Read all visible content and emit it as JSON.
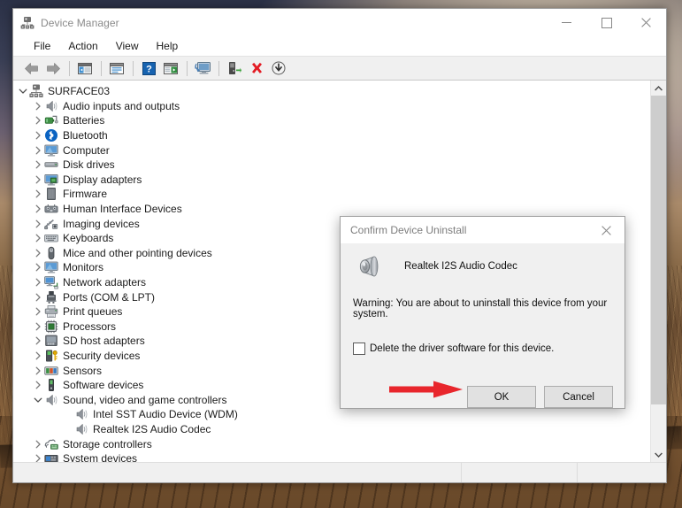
{
  "window": {
    "title": "Device Manager",
    "title_icon": "device-manager-icon",
    "controls": {
      "minimize": "Minimize",
      "maximize": "Maximize",
      "close": "Close"
    }
  },
  "menubar": {
    "items": [
      {
        "label": "File"
      },
      {
        "label": "Action"
      },
      {
        "label": "View"
      },
      {
        "label": "Help"
      }
    ]
  },
  "toolbar": {
    "buttons": [
      {
        "name": "back-icon",
        "title": "Back"
      },
      {
        "name": "forward-icon",
        "title": "Forward"
      },
      {
        "name": "show-hide-console-tree-icon",
        "title": "Show/Hide Console Tree"
      },
      {
        "name": "properties-icon",
        "title": "Properties"
      },
      {
        "name": "help-icon",
        "title": "Help"
      },
      {
        "name": "update-driver-icon",
        "title": "Update Driver Software"
      },
      {
        "name": "scan-for-hardware-changes-icon",
        "title": "Scan for hardware changes"
      },
      {
        "name": "enable-device-icon",
        "title": "Enable device"
      },
      {
        "name": "uninstall-device-icon",
        "title": "Uninstall device"
      },
      {
        "name": "disable-device-icon",
        "title": "Disable device"
      }
    ]
  },
  "tree": {
    "nodes": [
      {
        "label": "SURFACE03",
        "icon": "computer-root-icon",
        "indent": 0,
        "state": "expanded"
      },
      {
        "label": "Audio inputs and outputs",
        "icon": "speaker-icon",
        "indent": 1,
        "state": "collapsed"
      },
      {
        "label": "Batteries",
        "icon": "battery-icon",
        "indent": 1,
        "state": "collapsed"
      },
      {
        "label": "Bluetooth",
        "icon": "bluetooth-icon",
        "indent": 1,
        "state": "collapsed"
      },
      {
        "label": "Computer",
        "icon": "monitor-icon",
        "indent": 1,
        "state": "collapsed"
      },
      {
        "label": "Disk drives",
        "icon": "disk-drive-icon",
        "indent": 1,
        "state": "collapsed"
      },
      {
        "label": "Display adapters",
        "icon": "display-adapter-icon",
        "indent": 1,
        "state": "collapsed"
      },
      {
        "label": "Firmware",
        "icon": "firmware-icon",
        "indent": 1,
        "state": "collapsed"
      },
      {
        "label": "Human Interface Devices",
        "icon": "hid-icon",
        "indent": 1,
        "state": "collapsed"
      },
      {
        "label": "Imaging devices",
        "icon": "imaging-device-icon",
        "indent": 1,
        "state": "collapsed"
      },
      {
        "label": "Keyboards",
        "icon": "keyboard-icon",
        "indent": 1,
        "state": "collapsed"
      },
      {
        "label": "Mice and other pointing devices",
        "icon": "mouse-icon",
        "indent": 1,
        "state": "collapsed"
      },
      {
        "label": "Monitors",
        "icon": "monitor-icon",
        "indent": 1,
        "state": "collapsed"
      },
      {
        "label": "Network adapters",
        "icon": "network-adapter-icon",
        "indent": 1,
        "state": "collapsed"
      },
      {
        "label": "Ports (COM & LPT)",
        "icon": "port-icon",
        "indent": 1,
        "state": "collapsed"
      },
      {
        "label": "Print queues",
        "icon": "printer-icon",
        "indent": 1,
        "state": "collapsed"
      },
      {
        "label": "Processors",
        "icon": "processor-icon",
        "indent": 1,
        "state": "collapsed"
      },
      {
        "label": "SD host adapters",
        "icon": "sd-host-adapter-icon",
        "indent": 1,
        "state": "collapsed"
      },
      {
        "label": "Security devices",
        "icon": "security-device-icon",
        "indent": 1,
        "state": "collapsed"
      },
      {
        "label": "Sensors",
        "icon": "sensor-icon",
        "indent": 1,
        "state": "collapsed"
      },
      {
        "label": "Software devices",
        "icon": "software-device-icon",
        "indent": 1,
        "state": "collapsed"
      },
      {
        "label": "Sound, video and game controllers",
        "icon": "speaker-icon",
        "indent": 1,
        "state": "expanded"
      },
      {
        "label": "Intel SST Audio Device (WDM)",
        "icon": "speaker-icon",
        "indent": 2,
        "state": "leaf"
      },
      {
        "label": "Realtek I2S Audio Codec",
        "icon": "speaker-icon",
        "indent": 2,
        "state": "leaf"
      },
      {
        "label": "Storage controllers",
        "icon": "storage-controller-icon",
        "indent": 1,
        "state": "collapsed"
      },
      {
        "label": "System devices",
        "icon": "system-device-icon",
        "indent": 1,
        "state": "collapsed"
      }
    ]
  },
  "scrollbar": {
    "up_arrow": "scroll-up-icon",
    "down_arrow": "scroll-down-icon"
  },
  "statusbar": {
    "pane1": "",
    "pane2": "",
    "pane3": ""
  },
  "dialog": {
    "title": "Confirm Device Uninstall",
    "close_label": "Close",
    "device_icon": "speaker-large-icon",
    "device_name": "Realtek I2S Audio Codec",
    "warning": "Warning: You are about to uninstall this device from your system.",
    "checkbox": {
      "label": "Delete the driver software for this device.",
      "checked": false
    },
    "buttons": [
      {
        "label": "OK",
        "name": "ok-button"
      },
      {
        "label": "Cancel",
        "name": "cancel-button"
      }
    ]
  },
  "annotation": {
    "arrow": "red-arrow-pointing-to-ok-button",
    "color": "#e8262c"
  },
  "colors": {
    "window_bg": "#ffffff",
    "chrome_bg": "#f0f0f0",
    "dialog_bg": "#f0f0f0",
    "text": "#1b1b1b",
    "title_text": "#8a8a8a",
    "accent_red": "#e8262c",
    "scrollbar_thumb": "#cdcdcd"
  }
}
